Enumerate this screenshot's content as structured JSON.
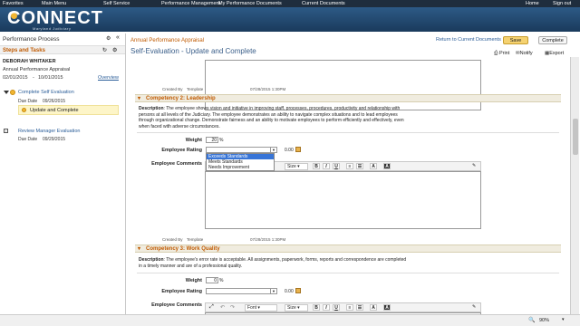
{
  "topnav": {
    "items": [
      "Favorites",
      "Main Menu",
      "Self Service",
      "Performance Management",
      "My Performance Documents",
      "Current Documents"
    ],
    "home": "Home",
    "signout": "Sign out"
  },
  "logo": {
    "text": "CONNECT",
    "sub": "Maryland Judiciary"
  },
  "left": {
    "title": "Performance Process",
    "section": "Steps and Tasks",
    "employee": "DEBORAH WHITAKER",
    "doc": "Annual Performance Appraisal",
    "date_from": "02/01/2015",
    "date_to": "10/01/2015",
    "overview": "Overview",
    "step1": {
      "title": "Complete Self Evaluation",
      "due_label": "Due Date",
      "due": "09/26/2015",
      "task": "Update and Complete"
    },
    "step2": {
      "title": "Review Manager Evaluation",
      "due_label": "Due Date",
      "due": "09/29/2015"
    }
  },
  "main": {
    "doc_type": "Annual Performance Appraisal",
    "page_title": "Self-Evaluation - Update and Complete",
    "return_link": "Return to Current Documents",
    "save": "Save",
    "complete": "Complete",
    "print": "Print",
    "notify": "Notify",
    "export": "Export",
    "created_label": "Created By",
    "created_by": "Template",
    "created_ts1": "07/28/2015 1:30PM",
    "created_ts2": "07/28/2015 1:30PM",
    "comp2": {
      "title": "Competency 2: Leadership",
      "desc_label": "Description",
      "desc": ": The employee shows vision and initiative in improving staff, processes, procedures, productivity and relationship with persons at all levels of the Judiciary. The employee demonstrates an ability to navigate complex situations and to lead employees through organizational change. Demonstrate fairness and an ability to motivate employees to perform efficiently and effectively, even when faced with adverse circumstances.",
      "weight_label": "Weight",
      "weight": "20",
      "pct": "%",
      "rating_label": "Employee Rating",
      "score": "0.00",
      "comments_label": "Employee Comments",
      "options": [
        "Exceeds Standards",
        "Meets Standards",
        "Needs Improvement"
      ],
      "size": "Size"
    },
    "comp3": {
      "title": "Competency 3: Work Quality",
      "desc_label": "Description",
      "desc": ": The employee's error rate is acceptable. All assignments, paperwork, forms, reports and correspondence are completed in a timely manner and are of a professional quality.",
      "weight_label": "Weight",
      "weight": "0",
      "pct": "%",
      "rating_label": "Employee Rating",
      "score": "0.00",
      "comments_label": "Employee Comments",
      "font": "Font",
      "size": "Size"
    }
  },
  "statusbar": {
    "zoom": "90%"
  }
}
